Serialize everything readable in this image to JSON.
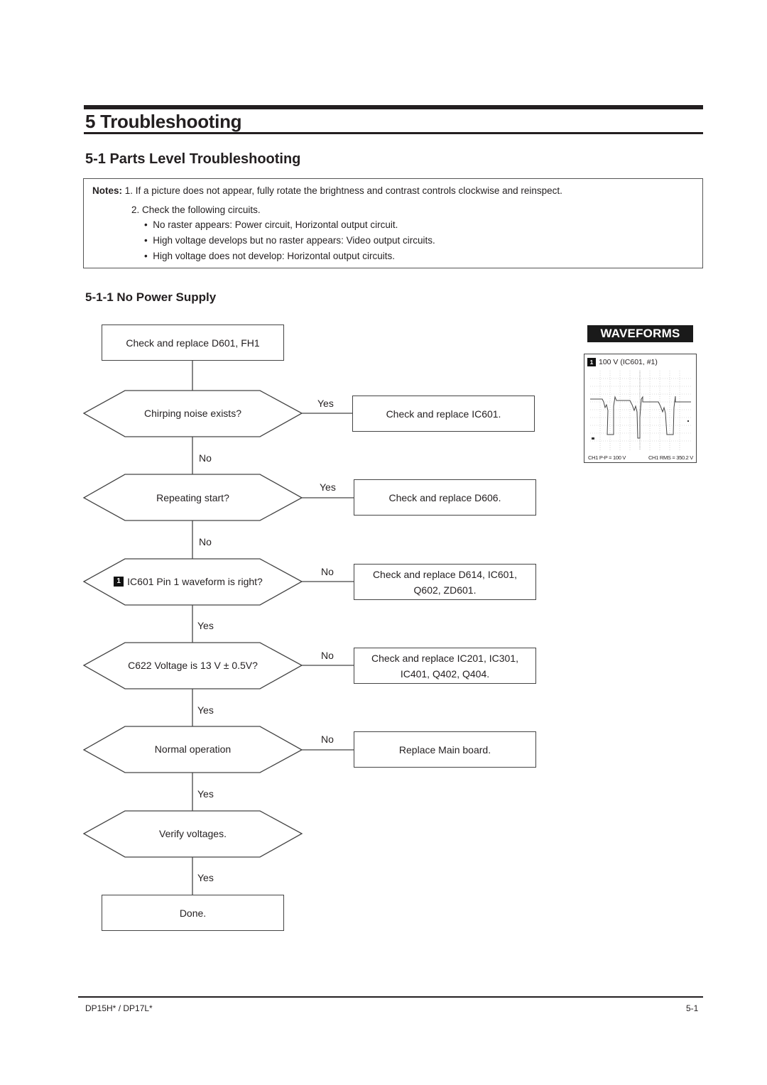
{
  "chapter": {
    "title": "5 Troubleshooting"
  },
  "section": {
    "title": "5-1 Parts Level Troubleshooting"
  },
  "notes": {
    "label": "Notes:",
    "item1": "1. If a picture does not appear, fully rotate the brightness and contrast controls clockwise and reinspect.",
    "item2": "2. Check the following circuits.",
    "bullets": [
      "No raster appears: Power circuit, Horizontal output circuit.",
      "High voltage develops but no raster appears: Video output circuits.",
      "High voltage does not develop: Horizontal output circuits."
    ],
    "bullet_glyph": "•"
  },
  "subsection": {
    "title": "5-1-1 No Power Supply"
  },
  "flowchart": {
    "start": "Check and replace D601, FH1",
    "decisions": [
      {
        "text": "Chirping noise exists?",
        "badge": "",
        "side_label": "Yes",
        "side_action": "Check and replace IC601.",
        "down_label": "No"
      },
      {
        "text": "Repeating start?",
        "badge": "",
        "side_label": "Yes",
        "side_action": "Check and replace D606.",
        "down_label": "No"
      },
      {
        "text": "IC601 Pin 1 waveform is right?",
        "badge": "1",
        "side_label": "No",
        "side_action": "Check and replace D614, IC601,\nQ602, ZD601.",
        "down_label": "Yes"
      },
      {
        "text": "C622 Voltage is 13 V ± 0.5V?",
        "badge": "",
        "side_label": "No",
        "side_action": "Check and replace IC201, IC301,\nIC401, Q402, Q404.",
        "down_label": "Yes"
      },
      {
        "text": "Normal operation",
        "badge": "",
        "side_label": "No",
        "side_action": "Replace Main board.",
        "down_label": "Yes"
      },
      {
        "text": "Verify voltages.",
        "badge": "",
        "side_label": "",
        "side_action": "",
        "down_label": "Yes"
      }
    ],
    "end": "Done."
  },
  "waveforms": {
    "header": "WAVEFORMS",
    "panels": [
      {
        "badge": "1",
        "title": "100 V (IC601, #1)",
        "footer_left": "CH1 P-P = 100 V",
        "footer_right": "CH1 RMS = 350.2 V"
      }
    ]
  },
  "footer": {
    "model": "DP15H* / DP17L*",
    "page": "5-1"
  }
}
